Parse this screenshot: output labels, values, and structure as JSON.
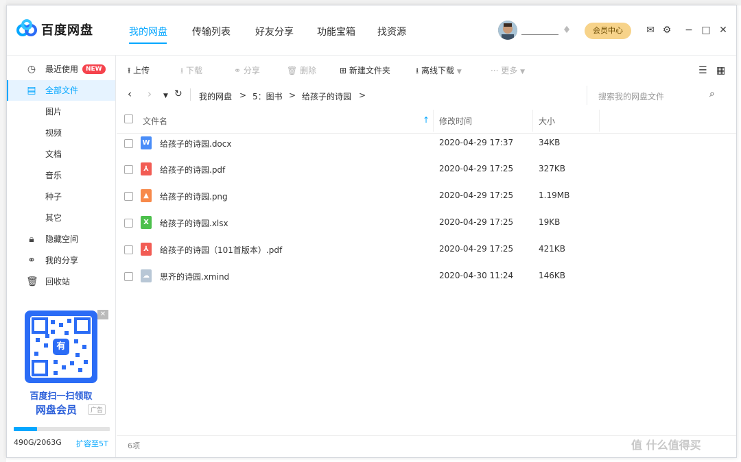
{
  "app": {
    "brand": "百度网盘",
    "nav_tabs": [
      "我的网盘",
      "传输列表",
      "好友分享",
      "功能宝箱",
      "找资源"
    ],
    "vip_button": "会员中心"
  },
  "sidebar": {
    "items": [
      {
        "label": "最近使用",
        "badge": "NEW"
      },
      {
        "label": "全部文件"
      },
      {
        "label": "图片"
      },
      {
        "label": "视频"
      },
      {
        "label": "文档"
      },
      {
        "label": "音乐"
      },
      {
        "label": "种子"
      },
      {
        "label": "其它"
      },
      {
        "label": "隐藏空间"
      },
      {
        "label": "我的分享"
      },
      {
        "label": "回收站"
      }
    ],
    "ad": {
      "qr_center": "有",
      "line1": "百度扫一扫领取",
      "line2": "网盘会员",
      "tag": "广告"
    },
    "quota": {
      "text": "490G/2063G",
      "used_fraction": 0.24,
      "expand": "扩容至5T"
    }
  },
  "toolbar": {
    "upload": "上传",
    "download": "下载",
    "share": "分享",
    "delete": "删除",
    "new_folder": "新建文件夹",
    "offline_download": "离线下载",
    "more": "更多"
  },
  "breadcrumb": {
    "items": [
      "我的网盘",
      "5：图书",
      "给孩子的诗园"
    ],
    "sep": ">"
  },
  "search": {
    "placeholder": "搜索我的网盘文件"
  },
  "table": {
    "headers": {
      "name": "文件名",
      "modified": "修改时间",
      "size": "大小"
    },
    "rows": [
      {
        "name": "给孩子的诗园.docx",
        "modified": "2020-04-29 17:37",
        "size": "34KB",
        "icon": "word-icon"
      },
      {
        "name": "给孩子的诗园.pdf",
        "modified": "2020-04-29 17:25",
        "size": "327KB",
        "icon": "pdf-icon"
      },
      {
        "name": "给孩子的诗园.png",
        "modified": "2020-04-29 17:25",
        "size": "1.19MB",
        "icon": "image-icon"
      },
      {
        "name": "给孩子的诗园.xlsx",
        "modified": "2020-04-29 17:25",
        "size": "19KB",
        "icon": "excel-icon"
      },
      {
        "name": "给孩子的诗园（101首版本）.pdf",
        "modified": "2020-04-29 17:25",
        "size": "421KB",
        "icon": "pdf-icon"
      },
      {
        "name": "思齐的诗园.xmind",
        "modified": "2020-04-30 11:24",
        "size": "146KB",
        "icon": "xmind-icon"
      }
    ]
  },
  "footer": {
    "count": "6项"
  },
  "watermark": "值 什么值得买",
  "colors": {
    "accent": "#06a7ff",
    "pdf": "#f25c54",
    "word": "#4a8df8",
    "image": "#f7894a",
    "excel": "#4cc04c",
    "xmind": "#b8c7d6"
  }
}
